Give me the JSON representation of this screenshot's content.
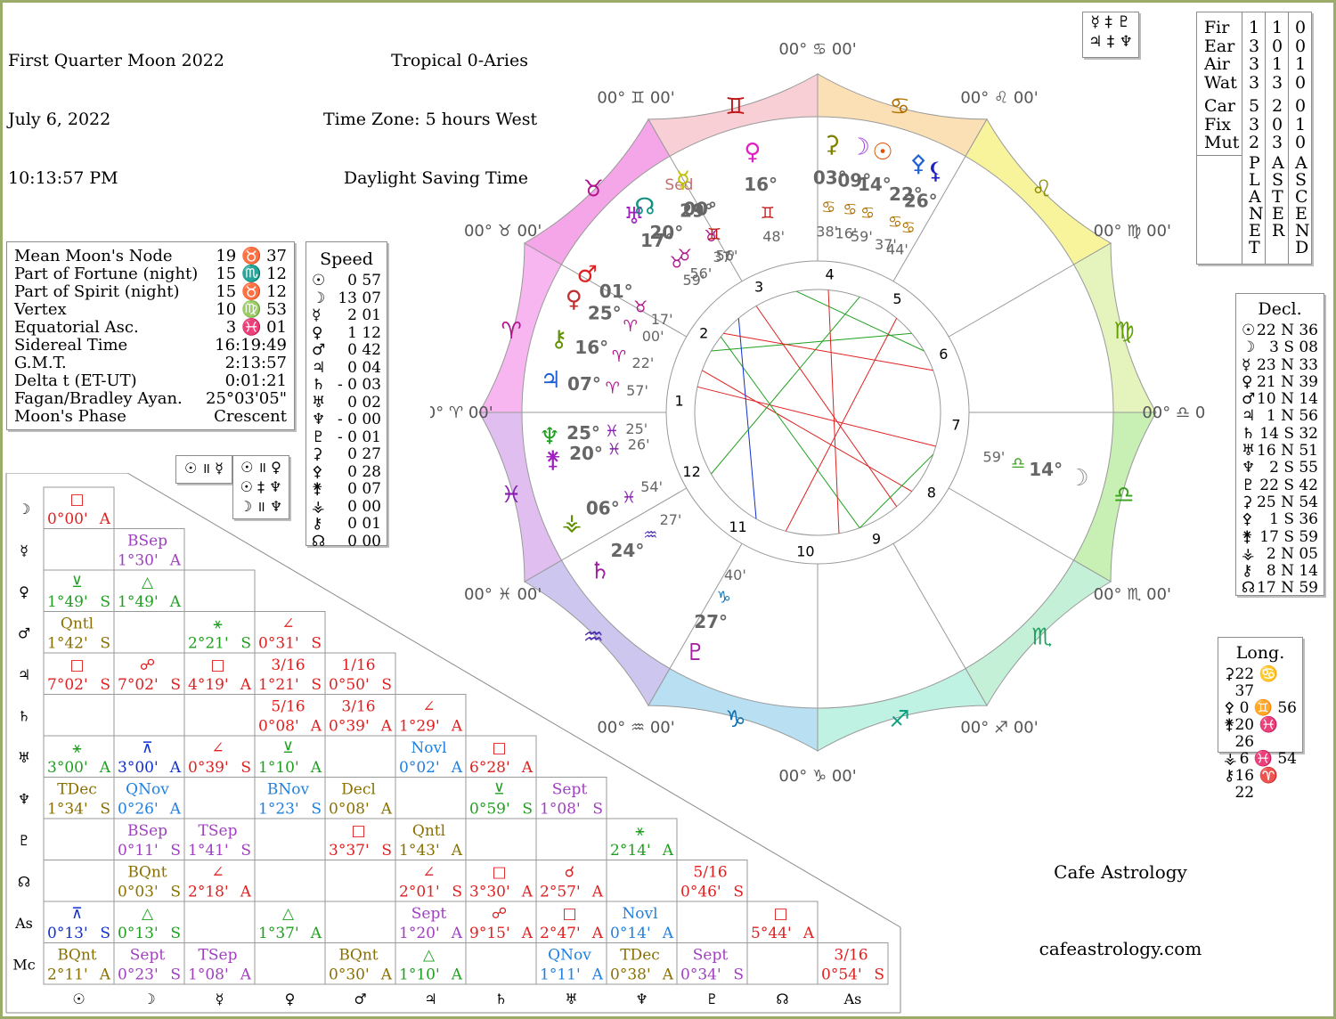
{
  "header": {
    "title": "First Quarter Moon 2022",
    "date": "July 6, 2022",
    "time": "10:13:57 PM",
    "zodiac": "Tropical 0-Aries",
    "timezone": "Time Zone: 5 hours West",
    "dst": "Daylight Saving Time"
  },
  "info": [
    {
      "label": "Mean Moon's Node",
      "value": "19 ♉ 37"
    },
    {
      "label": "Part of Fortune (night)",
      "value": "15 ♏ 12"
    },
    {
      "label": "Part of Spirit (night)",
      "value": "15 ♉ 12"
    },
    {
      "label": "Vertex",
      "value": "10 ♍ 53"
    },
    {
      "label": "Equatorial Asc.",
      "value": "3 ♓ 01"
    },
    {
      "label": "Sidereal Time",
      "value": "16:19:49"
    },
    {
      "label": "G.M.T.",
      "value": "2:13:57"
    },
    {
      "label": "Delta t (ET-UT)",
      "value": "0:01:21"
    },
    {
      "label": "Fagan/Bradley Ayan.",
      "value": "25°03'05\""
    },
    {
      "label": "Moon's Phase",
      "value": "Crescent"
    }
  ],
  "speed": {
    "title": "Speed",
    "rows": [
      {
        "g": "☉",
        "v": "0 57"
      },
      {
        "g": "☽",
        "v": "13 07"
      },
      {
        "g": "☿",
        "v": "2 01"
      },
      {
        "g": "♀",
        "v": "1 12"
      },
      {
        "g": "♂",
        "v": "0 42"
      },
      {
        "g": "♃",
        "v": "0 04"
      },
      {
        "g": "♄",
        "v": "- 0 03"
      },
      {
        "g": "♅",
        "v": "0 02"
      },
      {
        "g": "♆",
        "v": "- 0 00"
      },
      {
        "g": "♇",
        "v": "- 0 01"
      },
      {
        "g": "⚳",
        "v": "0 27"
      },
      {
        "g": "⚴",
        "v": "0 28"
      },
      {
        "g": "⚵",
        "v": "0 07"
      },
      {
        "g": "⚶",
        "v": "0 00"
      },
      {
        "g": "⚷",
        "v": "0 01"
      },
      {
        "g": "☊",
        "v": "0 00"
      }
    ]
  },
  "parallels": {
    "left": [
      "☉ ॥ ☿"
    ],
    "right": [
      "☉ ॥ ♀",
      "☉ ‡ ♆",
      "☽ ॥ ♆"
    ]
  },
  "top_box": {
    "row1": "☿ ‡ ♇",
    "row2": "♃ ‡ ♆"
  },
  "elements": {
    "rows": [
      {
        "label": "Fir",
        "a": "1",
        "b": "1",
        "c": "0"
      },
      {
        "label": "Ear",
        "a": "3",
        "b": "0",
        "c": "0"
      },
      {
        "label": "Air",
        "a": "3",
        "b": "1",
        "c": "1"
      },
      {
        "label": "Wat",
        "a": "3",
        "b": "3",
        "c": "0"
      },
      {
        "label": "Car",
        "a": "5",
        "b": "2",
        "c": "0"
      },
      {
        "label": "Fix",
        "a": "3",
        "b": "0",
        "c": "1"
      },
      {
        "label": "Mut",
        "a": "2",
        "b": "3",
        "c": "0"
      }
    ],
    "col_a": "PLANET",
    "col_b": "ASTER",
    "col_c": "ASCEND"
  },
  "decl": {
    "title": "Decl.",
    "rows": [
      {
        "g": "☉",
        "v": "22 N 36"
      },
      {
        "g": "☽",
        "v": "3 S 08"
      },
      {
        "g": "☿",
        "v": "23 N 33"
      },
      {
        "g": "♀",
        "v": "21 N 39"
      },
      {
        "g": "♂",
        "v": "10 N 14"
      },
      {
        "g": "♃",
        "v": "1 N 56"
      },
      {
        "g": "♄",
        "v": "14 S 32"
      },
      {
        "g": "♅",
        "v": "16 N 51"
      },
      {
        "g": "♆",
        "v": "2 S 55"
      },
      {
        "g": "♇",
        "v": "22 S 42"
      },
      {
        "g": "⚳",
        "v": "25 N 54"
      },
      {
        "g": "⚴",
        "v": "1 S 36"
      },
      {
        "g": "⚵",
        "v": "17 S 59"
      },
      {
        "g": "⚶",
        "v": "2 N 05"
      },
      {
        "g": "⚷",
        "v": "8 N 14"
      },
      {
        "g": "☊",
        "v": "17 N 59"
      }
    ]
  },
  "long": {
    "title": "Long.",
    "rows": [
      {
        "g": "⚳",
        "v": "22 ♋ 37"
      },
      {
        "g": "⚴",
        "v": "0 ♊ 56"
      },
      {
        "g": "⚵",
        "v": "20 ♓ 26"
      },
      {
        "g": "⚶",
        "v": "6 ♓ 54"
      },
      {
        "g": "⚷",
        "v": "16 ♈ 22"
      }
    ]
  },
  "credits": {
    "name": "Cafe Astrology",
    "url": "cafeastrology.com"
  },
  "grid": {
    "rows": [
      "☽",
      "☿",
      "♀",
      "♂",
      "♃",
      "♄",
      "♅",
      "♆",
      "♇",
      "☊",
      "As",
      "Mc"
    ],
    "cols": [
      "☉",
      "☽",
      "☿",
      "♀",
      "♂",
      "♃",
      "♄",
      "♅",
      "♆",
      "♇",
      "☊",
      "As"
    ],
    "cells": [
      {
        "r": 0,
        "c": 0,
        "sym": "□",
        "val": "0°00'",
        "t": "A",
        "col": "#e02020"
      },
      {
        "r": 1,
        "c": 1,
        "sym": "BSep",
        "val": "1°30'",
        "t": "A",
        "col": "#a040c0"
      },
      {
        "r": 2,
        "c": 0,
        "sym": "⊻",
        "val": "1°49'",
        "t": "S",
        "col": "#20a020"
      },
      {
        "r": 2,
        "c": 1,
        "sym": "△",
        "val": "1°49'",
        "t": "A",
        "col": "#20a020"
      },
      {
        "r": 3,
        "c": 0,
        "sym": "Qntl",
        "val": "1°42'",
        "t": "S",
        "col": "#8a7000"
      },
      {
        "r": 3,
        "c": 2,
        "sym": "⚹",
        "val": "2°21'",
        "t": "S",
        "col": "#20a020"
      },
      {
        "r": 3,
        "c": 3,
        "sym": "∠",
        "val": "0°31'",
        "t": "S",
        "col": "#e02020"
      },
      {
        "r": 4,
        "c": 0,
        "sym": "□",
        "val": "7°02'",
        "t": "S",
        "col": "#e02020"
      },
      {
        "r": 4,
        "c": 1,
        "sym": "☍",
        "val": "7°02'",
        "t": "S",
        "col": "#e02020"
      },
      {
        "r": 4,
        "c": 2,
        "sym": "□",
        "val": "4°19'",
        "t": "A",
        "col": "#e02020"
      },
      {
        "r": 4,
        "c": 3,
        "sym": "3/16",
        "val": "1°21'",
        "t": "S",
        "col": "#e02020"
      },
      {
        "r": 4,
        "c": 4,
        "sym": "1/16",
        "val": "0°50'",
        "t": "S",
        "col": "#e02020"
      },
      {
        "r": 5,
        "c": 3,
        "sym": "5/16",
        "val": "0°08'",
        "t": "A",
        "col": "#e02020"
      },
      {
        "r": 5,
        "c": 4,
        "sym": "3/16",
        "val": "0°39'",
        "t": "A",
        "col": "#e02020"
      },
      {
        "r": 5,
        "c": 5,
        "sym": "∠",
        "val": "1°29'",
        "t": "A",
        "col": "#e02020"
      },
      {
        "r": 6,
        "c": 0,
        "sym": "⚹",
        "val": "3°00'",
        "t": "A",
        "col": "#20a020"
      },
      {
        "r": 6,
        "c": 1,
        "sym": "⊼",
        "val": "3°00'",
        "t": "A",
        "col": "#1030d0"
      },
      {
        "r": 6,
        "c": 2,
        "sym": "∠",
        "val": "0°39'",
        "t": "S",
        "col": "#e02020"
      },
      {
        "r": 6,
        "c": 3,
        "sym": "⊻",
        "val": "1°10'",
        "t": "A",
        "col": "#20a020"
      },
      {
        "r": 6,
        "c": 5,
        "sym": "Novl",
        "val": "0°02'",
        "t": "A",
        "col": "#2080e0"
      },
      {
        "r": 6,
        "c": 6,
        "sym": "□",
        "val": "6°28'",
        "t": "A",
        "col": "#e02020"
      },
      {
        "r": 7,
        "c": 0,
        "sym": "TDec",
        "val": "1°34'",
        "t": "S",
        "col": "#8a7000"
      },
      {
        "r": 7,
        "c": 1,
        "sym": "QNov",
        "val": "0°26'",
        "t": "A",
        "col": "#2080e0"
      },
      {
        "r": 7,
        "c": 3,
        "sym": "BNov",
        "val": "1°23'",
        "t": "S",
        "col": "#2080e0"
      },
      {
        "r": 7,
        "c": 4,
        "sym": "Decl",
        "val": "0°08'",
        "t": "A",
        "col": "#8a7000"
      },
      {
        "r": 7,
        "c": 6,
        "sym": "⊻",
        "val": "0°59'",
        "t": "S",
        "col": "#20a020"
      },
      {
        "r": 7,
        "c": 7,
        "sym": "Sept",
        "val": "1°08'",
        "t": "S",
        "col": "#a040c0"
      },
      {
        "r": 8,
        "c": 1,
        "sym": "BSep",
        "val": "0°11'",
        "t": "S",
        "col": "#a040c0"
      },
      {
        "r": 8,
        "c": 2,
        "sym": "TSep",
        "val": "1°41'",
        "t": "S",
        "col": "#a040c0"
      },
      {
        "r": 8,
        "c": 4,
        "sym": "□",
        "val": "3°37'",
        "t": "S",
        "col": "#e02020"
      },
      {
        "r": 8,
        "c": 5,
        "sym": "Qntl",
        "val": "1°43'",
        "t": "A",
        "col": "#8a7000"
      },
      {
        "r": 8,
        "c": 8,
        "sym": "⚹",
        "val": "2°14'",
        "t": "A",
        "col": "#20a020"
      },
      {
        "r": 9,
        "c": 1,
        "sym": "BQnt",
        "val": "0°03'",
        "t": "S",
        "col": "#8a7000"
      },
      {
        "r": 9,
        "c": 2,
        "sym": "∠",
        "val": "2°18'",
        "t": "A",
        "col": "#e02020"
      },
      {
        "r": 9,
        "c": 5,
        "sym": "∠",
        "val": "2°01'",
        "t": "S",
        "col": "#e02020"
      },
      {
        "r": 9,
        "c": 6,
        "sym": "□",
        "val": "3°30'",
        "t": "A",
        "col": "#e02020"
      },
      {
        "r": 9,
        "c": 7,
        "sym": "☌",
        "val": "2°57'",
        "t": "A",
        "col": "#e02020"
      },
      {
        "r": 9,
        "c": 9,
        "sym": "5/16",
        "val": "0°46'",
        "t": "S",
        "col": "#e02020"
      },
      {
        "r": 10,
        "c": 0,
        "sym": "⊼",
        "val": "0°13'",
        "t": "S",
        "col": "#1030d0"
      },
      {
        "r": 10,
        "c": 1,
        "sym": "△",
        "val": "0°13'",
        "t": "S",
        "col": "#20a020"
      },
      {
        "r": 10,
        "c": 3,
        "sym": "△",
        "val": "1°37'",
        "t": "A",
        "col": "#20a020"
      },
      {
        "r": 10,
        "c": 5,
        "sym": "Sept",
        "val": "1°20'",
        "t": "A",
        "col": "#a040c0"
      },
      {
        "r": 10,
        "c": 6,
        "sym": "☍",
        "val": "9°15'",
        "t": "A",
        "col": "#e02020"
      },
      {
        "r": 10,
        "c": 7,
        "sym": "□",
        "val": "2°47'",
        "t": "A",
        "col": "#e02020"
      },
      {
        "r": 10,
        "c": 8,
        "sym": "Novl",
        "val": "0°14'",
        "t": "A",
        "col": "#2080e0"
      },
      {
        "r": 10,
        "c": 10,
        "sym": "□",
        "val": "5°44'",
        "t": "A",
        "col": "#e02020"
      },
      {
        "r": 11,
        "c": 0,
        "sym": "BQnt",
        "val": "2°11'",
        "t": "A",
        "col": "#8a7000"
      },
      {
        "r": 11,
        "c": 1,
        "sym": "Sept",
        "val": "0°23'",
        "t": "S",
        "col": "#a040c0"
      },
      {
        "r": 11,
        "c": 2,
        "sym": "TSep",
        "val": "1°08'",
        "t": "A",
        "col": "#a040c0"
      },
      {
        "r": 11,
        "c": 4,
        "sym": "BQnt",
        "val": "0°30'",
        "t": "A",
        "col": "#8a7000"
      },
      {
        "r": 11,
        "c": 5,
        "sym": "△",
        "val": "1°10'",
        "t": "A",
        "col": "#20a020"
      },
      {
        "r": 11,
        "c": 7,
        "sym": "QNov",
        "val": "1°11'",
        "t": "A",
        "col": "#2080e0"
      },
      {
        "r": 11,
        "c": 8,
        "sym": "TDec",
        "val": "0°38'",
        "t": "A",
        "col": "#8a7000"
      },
      {
        "r": 11,
        "c": 9,
        "sym": "Sept",
        "val": "0°34'",
        "t": "S",
        "col": "#a040c0"
      },
      {
        "r": 11,
        "c": 11,
        "sym": "3/16",
        "val": "0°54'",
        "t": "S",
        "col": "#e02020"
      }
    ]
  },
  "wheel": {
    "signs": [
      {
        "name": "aries-sign",
        "g": "♈",
        "color": "#f7b6f0",
        "gc": "#b0148c"
      },
      {
        "name": "taurus-sign",
        "g": "♉",
        "color": "#f4a6e8",
        "gc": "#b0148c"
      },
      {
        "name": "gemini-sign",
        "g": "♊",
        "color": "#f9cfd6",
        "gc": "#c01818"
      },
      {
        "name": "cancer-sign",
        "g": "♋",
        "color": "#fbe0b6",
        "gc": "#b07000"
      },
      {
        "name": "leo-sign",
        "g": "♌",
        "color": "#f8f49c",
        "gc": "#8a8a00"
      },
      {
        "name": "virgo-sign",
        "g": "♍",
        "color": "#e4f4bc",
        "gc": "#60a000"
      },
      {
        "name": "libra-sign",
        "g": "♎",
        "color": "#c8efb4",
        "gc": "#3aa020"
      },
      {
        "name": "scorpio-sign",
        "g": "♏",
        "color": "#c4f0d8",
        "gc": "#20a060"
      },
      {
        "name": "sagittarius-sign",
        "g": "♐",
        "color": "#bff2e2",
        "gc": "#10a080"
      },
      {
        "name": "capricorn-sign",
        "g": "♑",
        "color": "#b8e0f2",
        "gc": "#1070b0"
      },
      {
        "name": "aquarius-sign",
        "g": "♒",
        "color": "#cdc6ee",
        "gc": "#5030b0"
      },
      {
        "name": "pisces-sign",
        "g": "♓",
        "color": "#e0bff0",
        "gc": "#8a20b0"
      }
    ],
    "cusp_labels": [
      {
        "t": "00° ♈ 00'"
      },
      {
        "t": "00° ♉ 00'"
      },
      {
        "t": "00° ♊ 00'"
      },
      {
        "t": "00° ♋ 00'"
      },
      {
        "t": "00° ♌ 00'"
      },
      {
        "t": "00° ♍ 00'"
      },
      {
        "t": "00° ♎ 00'"
      },
      {
        "t": "00° ♏ 00'"
      },
      {
        "t": "00° ♐ 00'"
      },
      {
        "t": "00° ♑ 00'"
      },
      {
        "t": "00° ♒ 00'"
      },
      {
        "t": "00° ♓ 00'"
      }
    ],
    "house_numbers": [
      "1",
      "2",
      "3",
      "4",
      "5",
      "6",
      "7",
      "8",
      "9",
      "10",
      "11",
      "12"
    ],
    "planets": [
      {
        "name": "pluto-glyph",
        "g": "♇",
        "deg": "27°",
        "sign": "♑",
        "min": "40'",
        "retro": true,
        "col": "#a020a0"
      },
      {
        "name": "saturn-glyph",
        "g": "♄",
        "deg": "24°",
        "sign": "♒",
        "min": "27'",
        "retro": true,
        "col": "#a020a0"
      },
      {
        "name": "vesta-glyph",
        "g": "⚶",
        "deg": "06°",
        "sign": "♓",
        "min": "54'",
        "retro": false,
        "col": "#609000"
      },
      {
        "name": "pallas-glyph",
        "g": "⚵",
        "deg": "20°",
        "sign": "♓",
        "min": "26'",
        "retro": false,
        "col": "#a020c0"
      },
      {
        "name": "neptune-glyph",
        "g": "♆",
        "deg": "25°",
        "sign": "♓",
        "min": "25'",
        "retro": true,
        "col": "#20a020"
      },
      {
        "name": "jupiter-glyph",
        "g": "♃",
        "deg": "07°",
        "sign": "♈",
        "min": "57'",
        "retro": false,
        "col": "#2060d0"
      },
      {
        "name": "chiron-glyph",
        "g": "⚷",
        "deg": "16°",
        "sign": "♈",
        "min": "22'",
        "retro": false,
        "col": "#609000"
      },
      {
        "name": "venus-aster-glyph",
        "g": "♀",
        "deg": "25°",
        "sign": "♈",
        "min": "00'",
        "retro": false,
        "col": "#c03030"
      },
      {
        "name": "mars-glyph",
        "g": "♂",
        "deg": "01°",
        "sign": "♉",
        "min": "17'",
        "retro": false,
        "col": "#e02020"
      },
      {
        "name": "uranus-glyph",
        "g": "♅",
        "deg": "17°",
        "sign": "♉",
        "min": "59'",
        "retro": false,
        "col": "#a020c0"
      },
      {
        "name": "node-glyph",
        "g": "☊",
        "deg": "20°",
        "sign": "♉",
        "min": "56'",
        "retro": false,
        "col": "#109080"
      },
      {
        "name": "fortune-glyph",
        "g": "Sed",
        "deg": "29°",
        "sign": "♉",
        "min": "37'",
        "retro": false,
        "col": "#c07070"
      },
      {
        "name": "mercury-glyph",
        "g": "☿",
        "deg": "00°",
        "sign": "♊",
        "min": "56'",
        "retro": false,
        "col": "#c0c000"
      },
      {
        "name": "venus-glyph",
        "g": "♀",
        "deg": "16°",
        "sign": "♊",
        "min": "48'",
        "retro": false,
        "col": "#e020c0"
      },
      {
        "name": "ceres-glyph",
        "g": "⚳",
        "deg": "03°",
        "sign": "♋",
        "min": "38'",
        "retro": false,
        "col": "#808000"
      },
      {
        "name": "moon-glyph",
        "g": "☽",
        "deg": "09°",
        "sign": "♋",
        "min": "16'",
        "retro": false,
        "col": "#a040e0"
      },
      {
        "name": "sun-glyph",
        "g": "☉",
        "deg": "14°",
        "sign": "♋",
        "min": "59'",
        "retro": true,
        "col": "#e05000"
      },
      {
        "name": "juno-glyph",
        "g": "⚴",
        "deg": "22°",
        "sign": "♋",
        "min": "37'",
        "retro": false,
        "col": "#2060d0"
      },
      {
        "name": "lilith-glyph",
        "g": "⚸",
        "deg": "26°",
        "sign": "♋",
        "min": "44'",
        "retro": false,
        "col": "#2020c0"
      },
      {
        "name": "moon-house-glyph",
        "g": "☽",
        "deg": "14°",
        "sign": "♎",
        "min": "59'",
        "retro": false,
        "col": "#909090"
      }
    ]
  }
}
